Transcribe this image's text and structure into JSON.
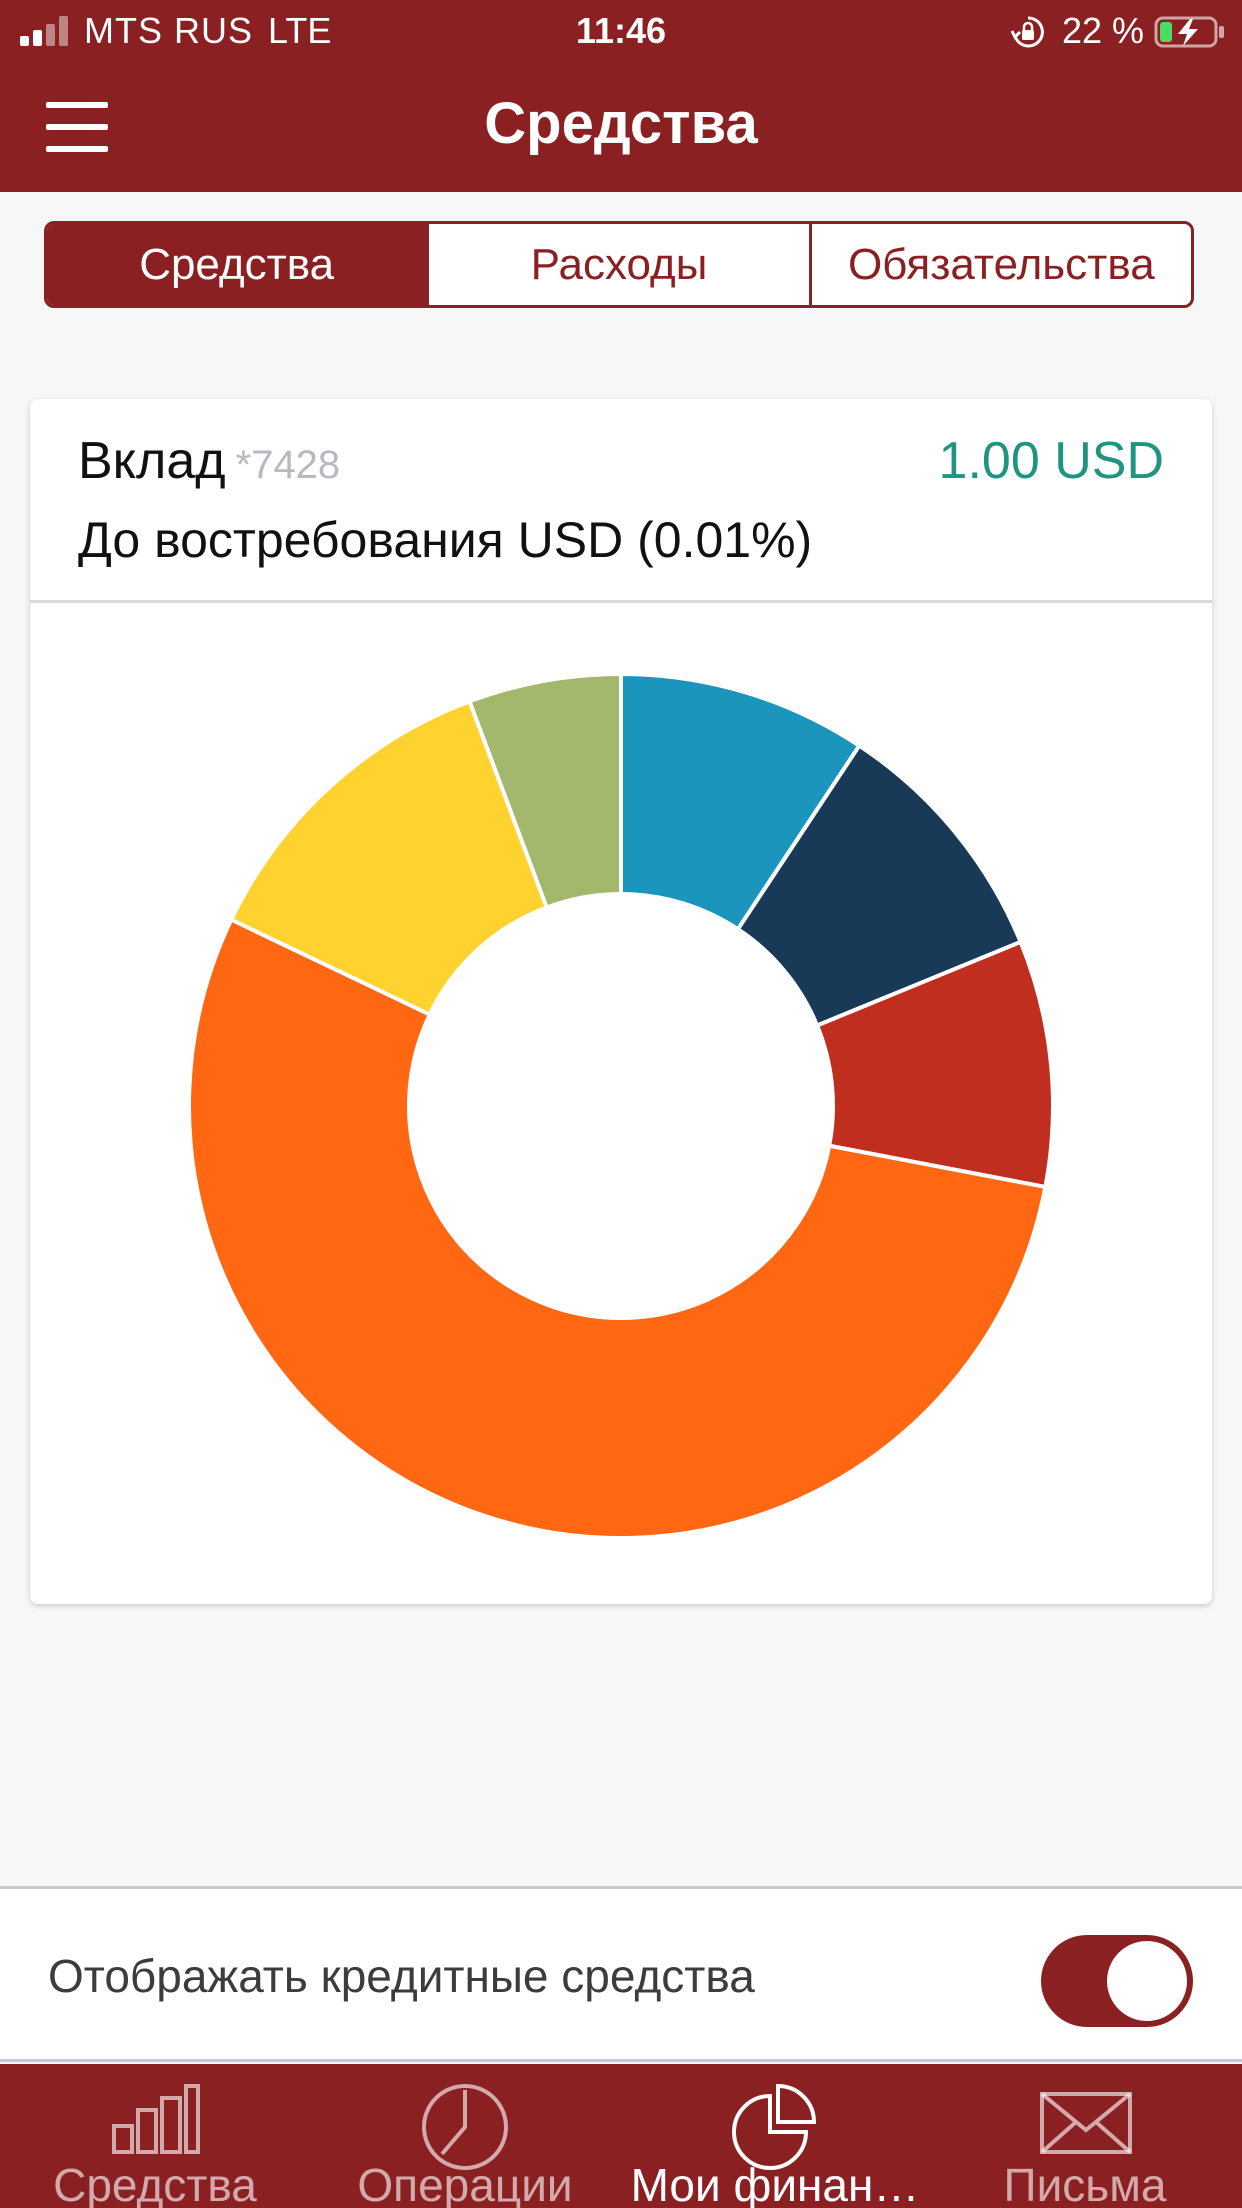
{
  "status_bar": {
    "carrier": "MTS RUS",
    "network": "LTE",
    "time": "11:46",
    "battery": "22 %"
  },
  "nav": {
    "title": "Средства",
    "menu_icon": "hamburger-menu-icon"
  },
  "segments": [
    {
      "label": "Средства",
      "active": true
    },
    {
      "label": "Расходы",
      "active": false
    },
    {
      "label": "Обязательства",
      "active": false
    }
  ],
  "account": {
    "name": "Вклад",
    "number": "*7428",
    "amount": "1.00 USD",
    "description": "До востребования USD (0.01%)"
  },
  "chart_data": {
    "type": "pie",
    "donut": true,
    "slices": [
      {
        "value": 9.3,
        "color": "#1c95bd"
      },
      {
        "value": 9.5,
        "color": "#193a56"
      },
      {
        "value": 9.2,
        "color": "#c02e20"
      },
      {
        "value": 54.1,
        "color": "#ff6713"
      },
      {
        "value": 12.2,
        "color": "#ffd230"
      },
      {
        "value": 5.7,
        "color": "#a3b86c"
      }
    ]
  },
  "settings": {
    "show_credit_label": "Отображать кредитные средства",
    "show_credit_on": true
  },
  "tabbar": {
    "items": [
      {
        "label": "Средства",
        "icon": "bar-chart-icon",
        "active": false
      },
      {
        "label": "Операции",
        "icon": "clock-icon",
        "active": false
      },
      {
        "label": "Мои финан…",
        "icon": "pie-chart-icon",
        "active": true
      },
      {
        "label": "Письма",
        "icon": "envelope-icon",
        "active": false
      }
    ]
  },
  "colors": {
    "brand": "#8b2022",
    "amount": "#1f9480"
  }
}
